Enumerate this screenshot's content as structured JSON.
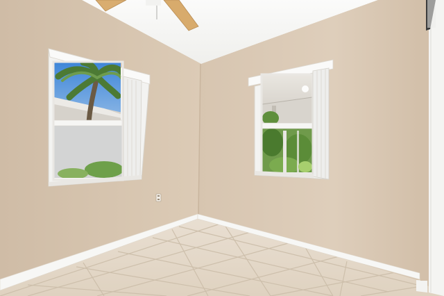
{
  "scene": {
    "kind": "empty-room-interior",
    "colors": {
      "left_wall": "#d8c6b1",
      "back_wall": "#ddcdb9",
      "ceiling": "#f7f7f5",
      "floor_tile": "#e6dbcc",
      "grout": "#cfc1ad",
      "baseboard": "#f8f8f6",
      "window_frame": "#f2f2f0",
      "sky": "#4d8fd6",
      "foliage": "#5f8f3c",
      "fan_blade": "#d6aa6e",
      "door": "#f4f4f2"
    }
  }
}
